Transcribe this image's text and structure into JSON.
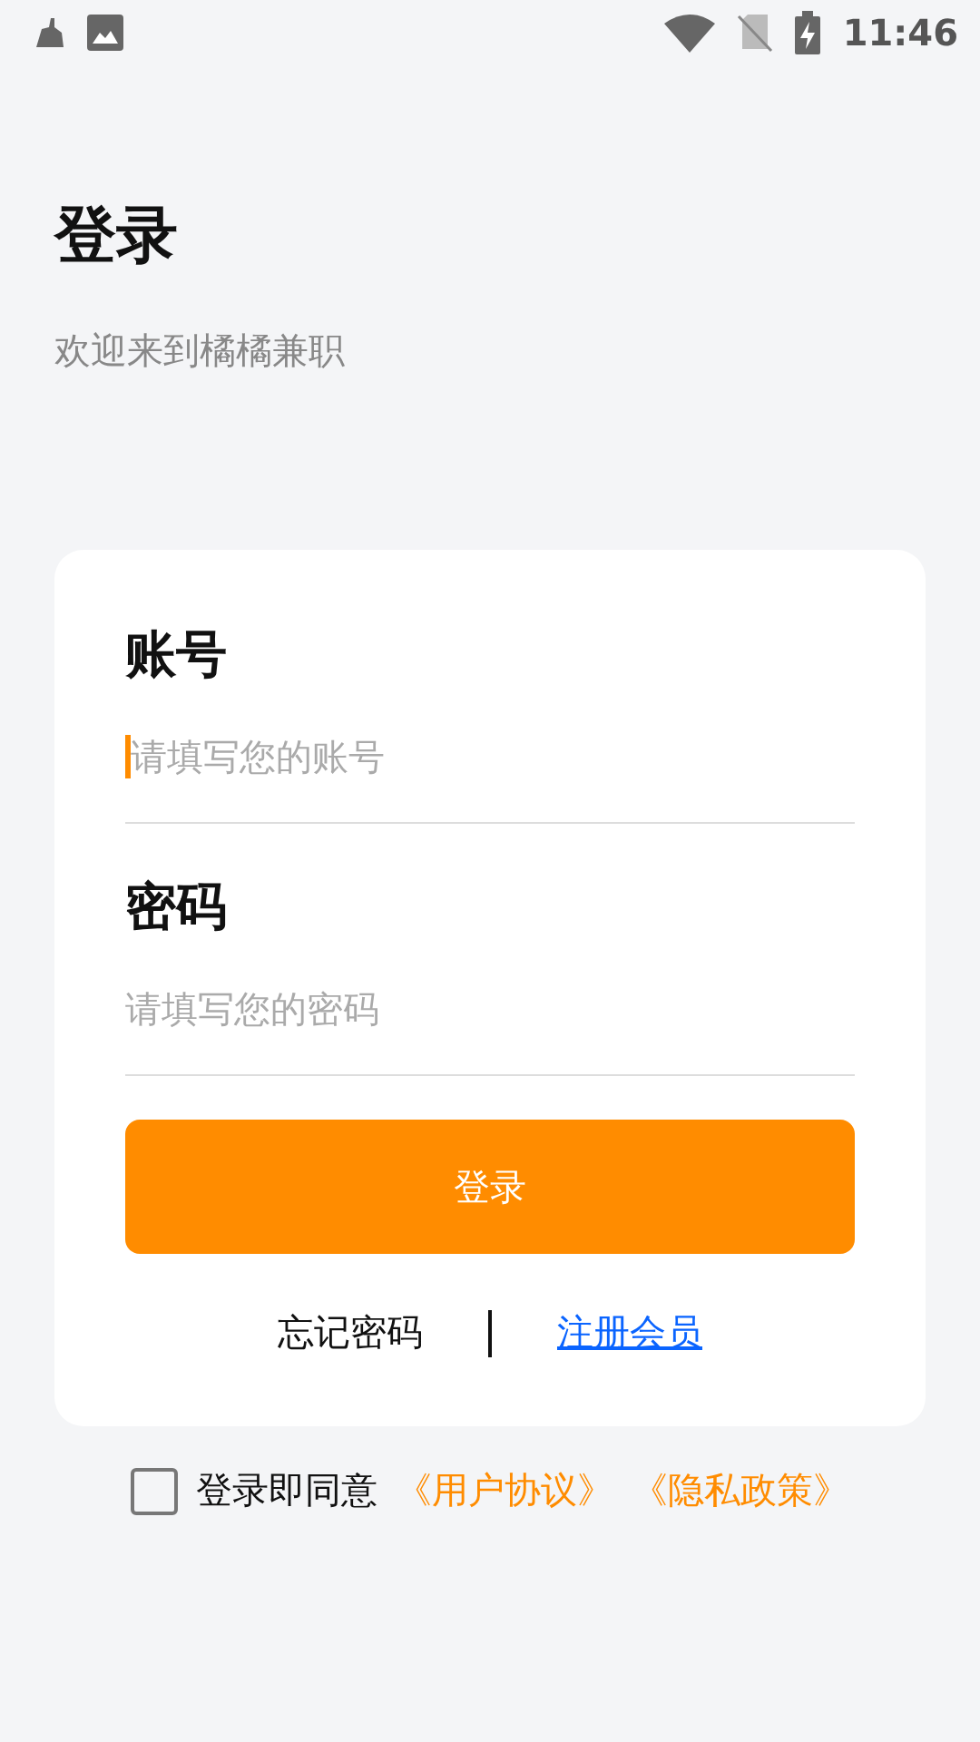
{
  "status_bar": {
    "time": "11:46"
  },
  "header": {
    "title": "登录",
    "subtitle": "欢迎来到橘橘兼职"
  },
  "form": {
    "fields": [
      {
        "label": "账号",
        "placeholder": "请填写您的账号",
        "focused": true
      },
      {
        "label": "密码",
        "placeholder": "请填写您的密码",
        "focused": false
      }
    ],
    "submit": "登录",
    "forgot_link": "忘记密码",
    "register_link": "注册会员"
  },
  "agreement": {
    "checked": false,
    "text": "登录即同意",
    "links": [
      "《用户协议》",
      "《隐私政策》"
    ]
  }
}
